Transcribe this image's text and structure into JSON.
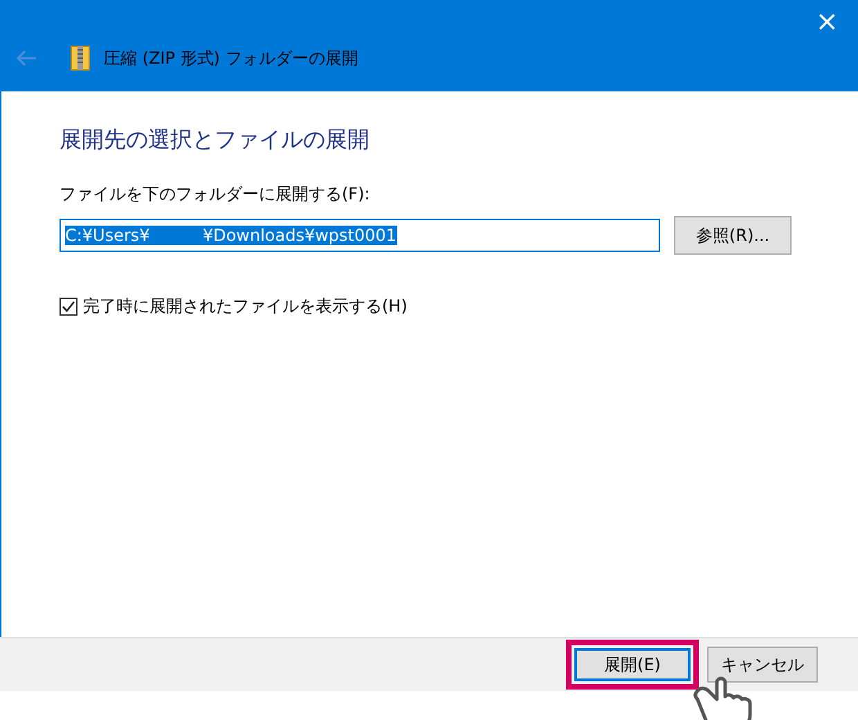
{
  "window": {
    "title": "圧縮 (ZIP 形式) フォルダーの展開",
    "close": "×"
  },
  "heading": "展開先の選択とファイルの展開",
  "destination": {
    "label": "ファイルを下のフォルダーに展開する(F):",
    "value": "C:¥Users¥          ¥Downloads¥wpst0001",
    "selected": true
  },
  "browse_button": "参照(R)...",
  "show_files": {
    "label": "完了時に展開されたファイルを表示する(H)",
    "checked": true
  },
  "buttons": [
    {
      "label": "展開(E)",
      "highlighted": true
    },
    {
      "label": "キャンセル",
      "highlighted": false
    }
  ]
}
